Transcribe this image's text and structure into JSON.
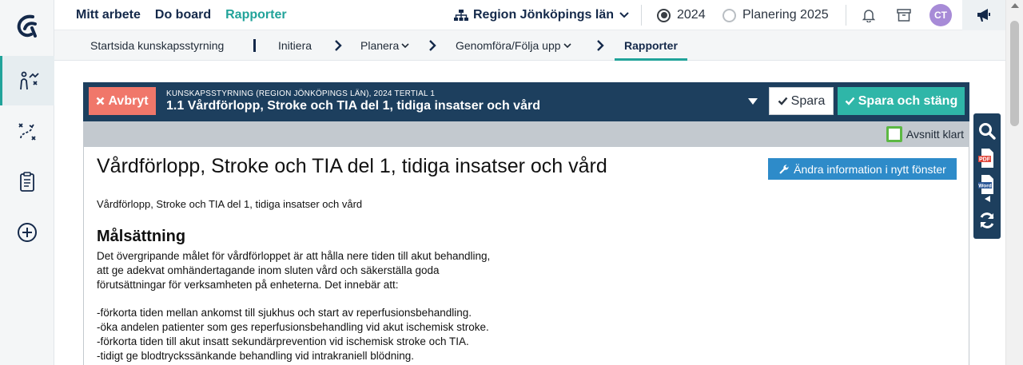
{
  "colors": {
    "accent": "#21a39a",
    "navy": "#1d3f5e",
    "cancel": "#f0776a",
    "save_close": "#2fb6a8",
    "edit": "#2e8bc9"
  },
  "nav": {
    "items": [
      {
        "label": "Mitt arbete"
      },
      {
        "label": "Do board"
      },
      {
        "label": "Rapporter"
      }
    ],
    "org": "Region Jönköpings län",
    "years": [
      {
        "label": "2024",
        "selected": true
      },
      {
        "label": "Planering 2025",
        "selected": false
      }
    ],
    "avatar": "CT"
  },
  "breadcrumbs": [
    {
      "label": "Startsida kunskapsstyrning"
    },
    {
      "label": "Initiera"
    },
    {
      "label": "Planera"
    },
    {
      "label": "Genomföra/Följa upp"
    },
    {
      "label": "Rapporter"
    }
  ],
  "editor": {
    "cancel_label": "Avbryt",
    "subtitle": "KUNSKAPSSTYRNING (REGION JÖNKÖPINGS LÄN), 2024 TERTIAL 1",
    "title": "1.1 Vårdförlopp, Stroke och TIA del 1, tidiga insatser och vård",
    "save_label": "Spara",
    "save_close_label": "Spara och stäng",
    "section_done_label": "Avsnitt klart"
  },
  "document": {
    "title": "Vårdförlopp, Stroke och TIA del 1, tidiga insatser och vård",
    "edit_button": "Ändra information i nytt fönster",
    "subtitle": "Vårdförlopp, Stroke och TIA del 1, tidiga insatser och vård",
    "heading": "Målsättning",
    "paragraph_lines": [
      "Det övergripande målet för vårdförloppet är att hålla nere tiden till akut behandling,",
      "att ge adekvat omhändertagande inom sluten vård och säkerställa goda",
      "förutsättningar för verksamheten på enheterna. Det innebär att:"
    ],
    "list": [
      "-förkorta tiden mellan ankomst till sjukhus och start av reperfusionsbehandling.",
      "-öka andelen patienter som ges reperfusionsbehandling vid akut ischemisk stroke.",
      "-förkorta tiden till akut insatt sekundärprevention vid ischemisk stroke och TIA.",
      "-tidigt ge blodtryckssänkande behandling vid intrakraniell blödning."
    ]
  },
  "side_tools": {
    "pdf_label": "PDF",
    "word_label": "Word"
  }
}
